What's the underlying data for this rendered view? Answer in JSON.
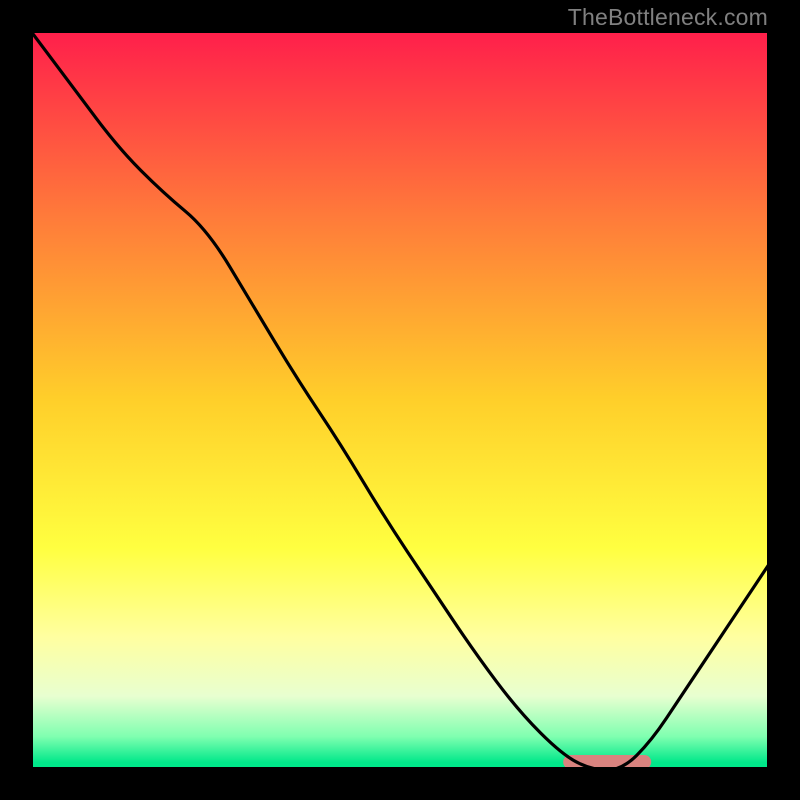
{
  "watermark": "TheBottleneck.com",
  "chart_data": {
    "type": "line",
    "title": "",
    "xlabel": "",
    "ylabel": "",
    "xlim": [
      0,
      100
    ],
    "ylim": [
      0,
      100
    ],
    "grid": false,
    "gradient_stops": [
      {
        "offset": 0.0,
        "color": "#ff1e4b"
      },
      {
        "offset": 0.25,
        "color": "#ff7a3a"
      },
      {
        "offset": 0.5,
        "color": "#ffcf2a"
      },
      {
        "offset": 0.7,
        "color": "#ffff40"
      },
      {
        "offset": 0.82,
        "color": "#ffffa0"
      },
      {
        "offset": 0.9,
        "color": "#e8ffd0"
      },
      {
        "offset": 0.955,
        "color": "#7fffb0"
      },
      {
        "offset": 0.99,
        "color": "#00e88a"
      },
      {
        "offset": 1.0,
        "color": "#00e88a"
      }
    ],
    "series": [
      {
        "name": "curve",
        "x": [
          0,
          6,
          12,
          18,
          24,
          30,
          36,
          42,
          48,
          54,
          60,
          66,
          72,
          76,
          80,
          84,
          88,
          92,
          96,
          100
        ],
        "y": [
          100,
          92,
          84,
          78,
          73,
          63,
          53,
          44,
          34,
          25,
          16,
          8,
          2,
          0,
          0,
          4,
          10,
          16,
          22,
          28
        ]
      }
    ],
    "marker": {
      "name": "highlight",
      "x_start": 73,
      "x_end": 83,
      "y": 0,
      "color": "#d9837f",
      "thickness": 14
    }
  }
}
